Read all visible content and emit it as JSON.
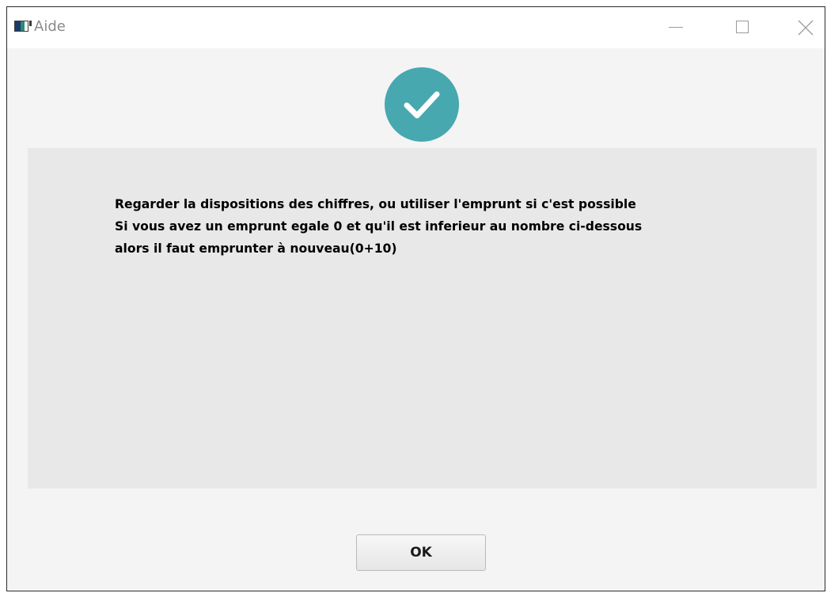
{
  "window": {
    "title": "Aide",
    "app_icon": "java-app-icon",
    "controls": {
      "minimize": "minimize-icon",
      "maximize": "maximize-icon",
      "close": "close-icon"
    }
  },
  "dialog": {
    "status_icon": "checkmark-icon",
    "status_color": "#47a8b0",
    "message_lines": [
      "Regarder la dispositions des chiffres, ou utiliser l'emprunt si c'est possible",
      "Si vous avez un emprunt egale 0 et qu'il est inferieur au nombre ci-dessous",
      "alors il faut emprunter à nouveau(0+10)"
    ],
    "ok_label": "OK"
  }
}
